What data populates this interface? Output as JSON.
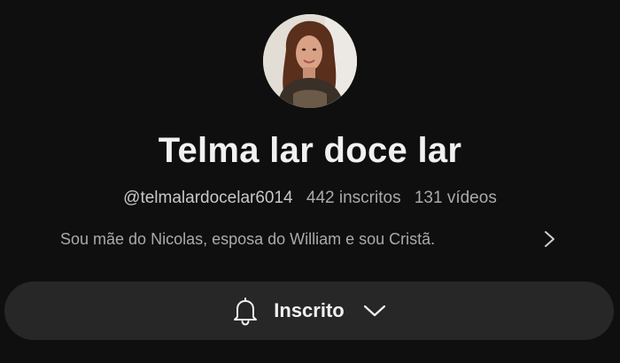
{
  "channel": {
    "name": "Telma lar doce lar",
    "handle": "@telmalardocelar6014",
    "subscribers": "442 inscritos",
    "videos": "131 vídeos",
    "description": "Sou mãe do Nicolas, esposa do William e sou Cristã."
  },
  "subscribe_button": {
    "label": "Inscrito",
    "icon": "bell-icon",
    "dropdown_icon": "chevron-down-icon"
  },
  "colors": {
    "background": "#0f0f0f",
    "button_background": "#272727",
    "primary_text": "#f1f1f1",
    "secondary_text": "#aaaaaa"
  }
}
